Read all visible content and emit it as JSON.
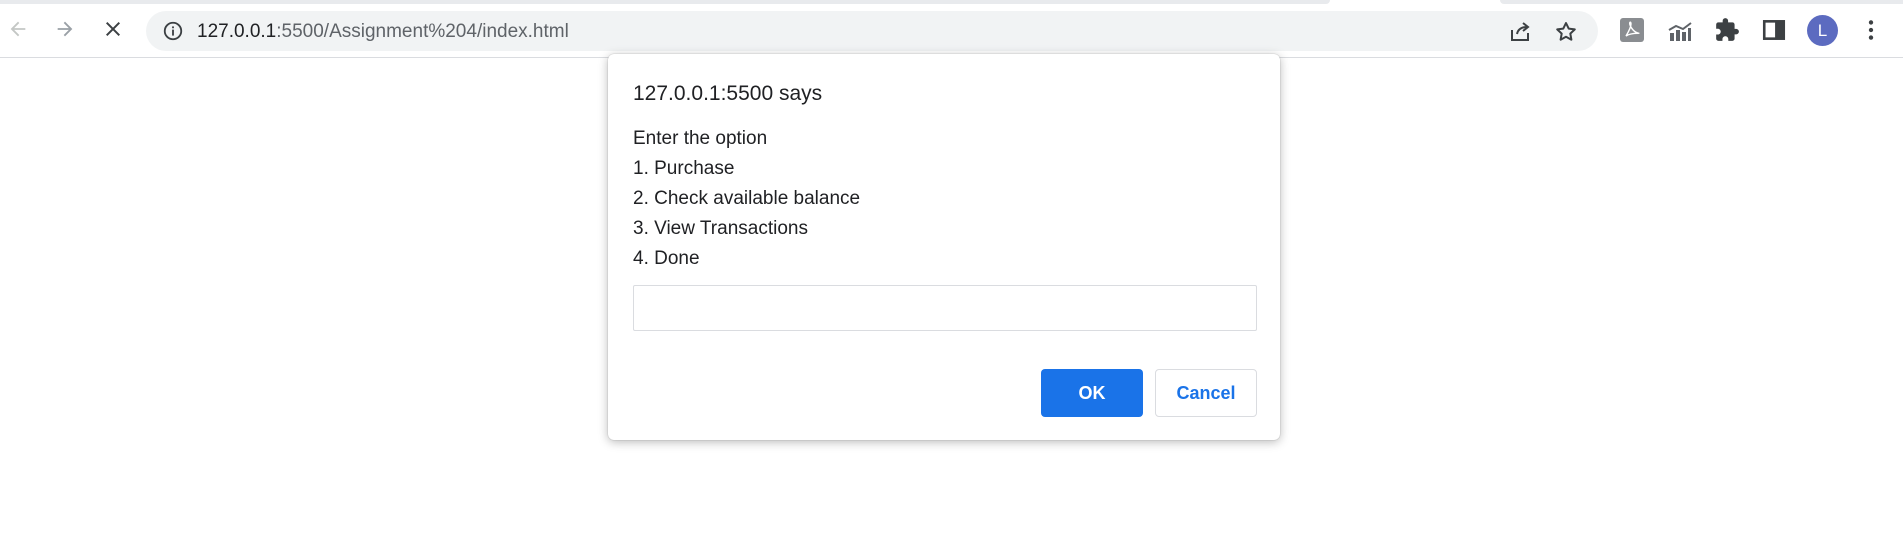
{
  "browser": {
    "address_bar": {
      "host": "127.0.0.1",
      "rest": ":5500/Assignment%204/index.html"
    },
    "profile_initial": "L",
    "icons": {
      "back": "back-arrow-icon",
      "forward": "forward-arrow-icon",
      "stop": "close-icon",
      "site_info": "info-icon",
      "share": "share-icon",
      "bookmark": "star-icon",
      "pdf_extension": "acrobat-icon",
      "chart_extension": "chart-icon",
      "extensions": "puzzle-icon",
      "side_panel": "side-panel-icon",
      "menu": "kebab-menu-icon"
    }
  },
  "dialog": {
    "title": "127.0.0.1:5500 says",
    "message_lines": [
      "Enter the option",
      "1. Purchase",
      "2. Check available balance",
      "3. View Transactions",
      "4. Done"
    ],
    "input_value": "",
    "ok_label": "OK",
    "cancel_label": "Cancel"
  },
  "colors": {
    "accent": "#1a73e8",
    "avatar": "#5c6bc0",
    "omnibox_bg": "#f1f3f4"
  }
}
